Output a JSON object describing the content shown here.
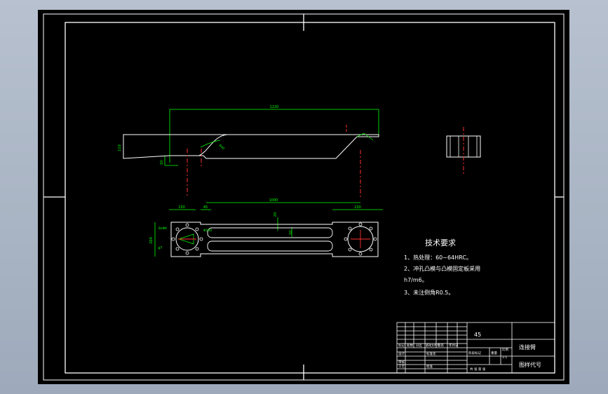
{
  "technical_requirements": {
    "title": "技术要求",
    "items": [
      "1、热处理：60~64HRC。",
      "2、冲孔凸模与凸模固定板采用",
      "h7/m6。",
      "3、未注倒角R0.5。"
    ]
  },
  "title_block": {
    "material": "45",
    "name": "连接臂",
    "drawing_code": "图样代号",
    "stage_mark": "阶段标记",
    "weight": "重量",
    "scale": "比例",
    "scale_value": "1:1",
    "sheet_info": "共 张 第 张",
    "mark": "标记",
    "count": "处数",
    "zone": "分区",
    "change_no": "更改文件号",
    "signature": "签名",
    "date": "年月日",
    "designer": "设计",
    "standardize": "标准化",
    "review": "审核",
    "process": "工艺",
    "approve": "批准"
  },
  "dimensions": {
    "top_length": "1220",
    "top_height": "110",
    "left_small": "10",
    "bottom_length": "1000",
    "left_offset": "150",
    "right_offset": "230",
    "slot_offset": "45",
    "slot_width": "20",
    "slot_length": "10",
    "end_height": "200",
    "hole_note_left": "8xΦ6",
    "hole_note_circle": "Φ100",
    "hole_note_pcd": "Φ7",
    "radius": "R40",
    "chamfer": "45°"
  },
  "colors": {
    "background": "#000000",
    "frame": "#ffffff",
    "part": "#ffffff",
    "dimension": "#00ff00",
    "center": "#ff3030",
    "hidden": "#ff3030",
    "text": "#ffffff"
  }
}
